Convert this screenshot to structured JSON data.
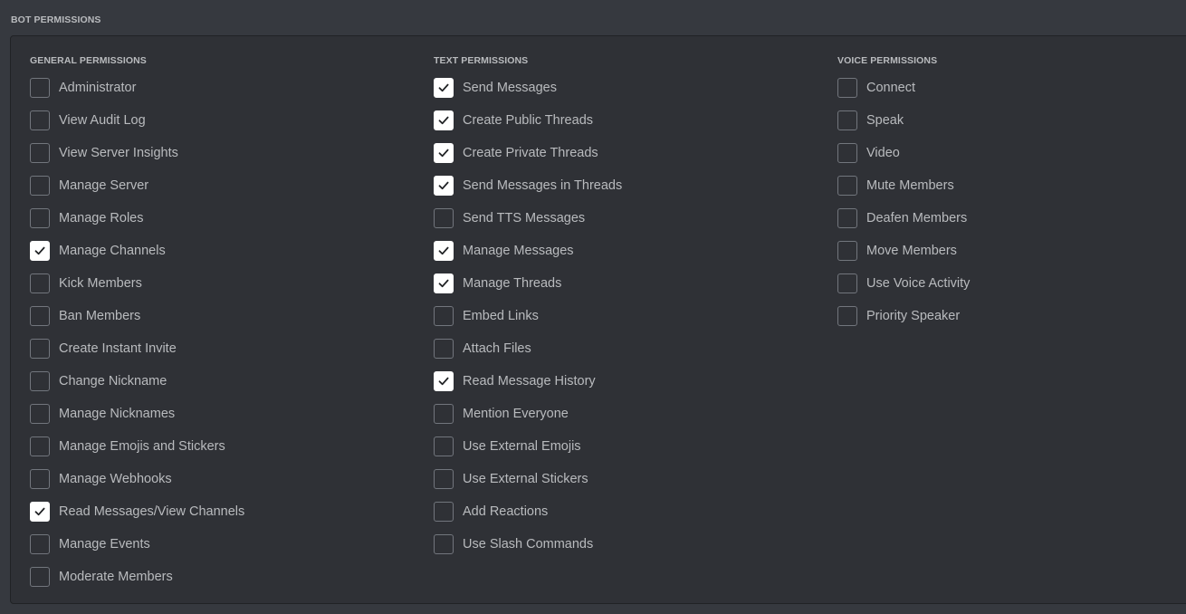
{
  "section_title": "BOT PERMISSIONS",
  "colors": {
    "background": "#36393f",
    "panel": "#2f3136",
    "text": "#b9bbbe",
    "checkbox_checked": "#ffffff"
  },
  "columns": [
    {
      "key": "general",
      "title": "GENERAL PERMISSIONS",
      "items": [
        {
          "label": "Administrator",
          "checked": false
        },
        {
          "label": "View Audit Log",
          "checked": false
        },
        {
          "label": "View Server Insights",
          "checked": false
        },
        {
          "label": "Manage Server",
          "checked": false
        },
        {
          "label": "Manage Roles",
          "checked": false
        },
        {
          "label": "Manage Channels",
          "checked": true
        },
        {
          "label": "Kick Members",
          "checked": false
        },
        {
          "label": "Ban Members",
          "checked": false
        },
        {
          "label": "Create Instant Invite",
          "checked": false
        },
        {
          "label": "Change Nickname",
          "checked": false
        },
        {
          "label": "Manage Nicknames",
          "checked": false
        },
        {
          "label": "Manage Emojis and Stickers",
          "checked": false
        },
        {
          "label": "Manage Webhooks",
          "checked": false
        },
        {
          "label": "Read Messages/View Channels",
          "checked": true
        },
        {
          "label": "Manage Events",
          "checked": false
        },
        {
          "label": "Moderate Members",
          "checked": false
        }
      ]
    },
    {
      "key": "text",
      "title": "TEXT PERMISSIONS",
      "items": [
        {
          "label": "Send Messages",
          "checked": true
        },
        {
          "label": "Create Public Threads",
          "checked": true
        },
        {
          "label": "Create Private Threads",
          "checked": true
        },
        {
          "label": "Send Messages in Threads",
          "checked": true
        },
        {
          "label": "Send TTS Messages",
          "checked": false
        },
        {
          "label": "Manage Messages",
          "checked": true
        },
        {
          "label": "Manage Threads",
          "checked": true
        },
        {
          "label": "Embed Links",
          "checked": false
        },
        {
          "label": "Attach Files",
          "checked": false
        },
        {
          "label": "Read Message History",
          "checked": true
        },
        {
          "label": "Mention Everyone",
          "checked": false
        },
        {
          "label": "Use External Emojis",
          "checked": false
        },
        {
          "label": "Use External Stickers",
          "checked": false
        },
        {
          "label": "Add Reactions",
          "checked": false
        },
        {
          "label": "Use Slash Commands",
          "checked": false
        }
      ]
    },
    {
      "key": "voice",
      "title": "VOICE PERMISSIONS",
      "items": [
        {
          "label": "Connect",
          "checked": false
        },
        {
          "label": "Speak",
          "checked": false
        },
        {
          "label": "Video",
          "checked": false
        },
        {
          "label": "Mute Members",
          "checked": false
        },
        {
          "label": "Deafen Members",
          "checked": false
        },
        {
          "label": "Move Members",
          "checked": false
        },
        {
          "label": "Use Voice Activity",
          "checked": false
        },
        {
          "label": "Priority Speaker",
          "checked": false
        }
      ]
    }
  ]
}
